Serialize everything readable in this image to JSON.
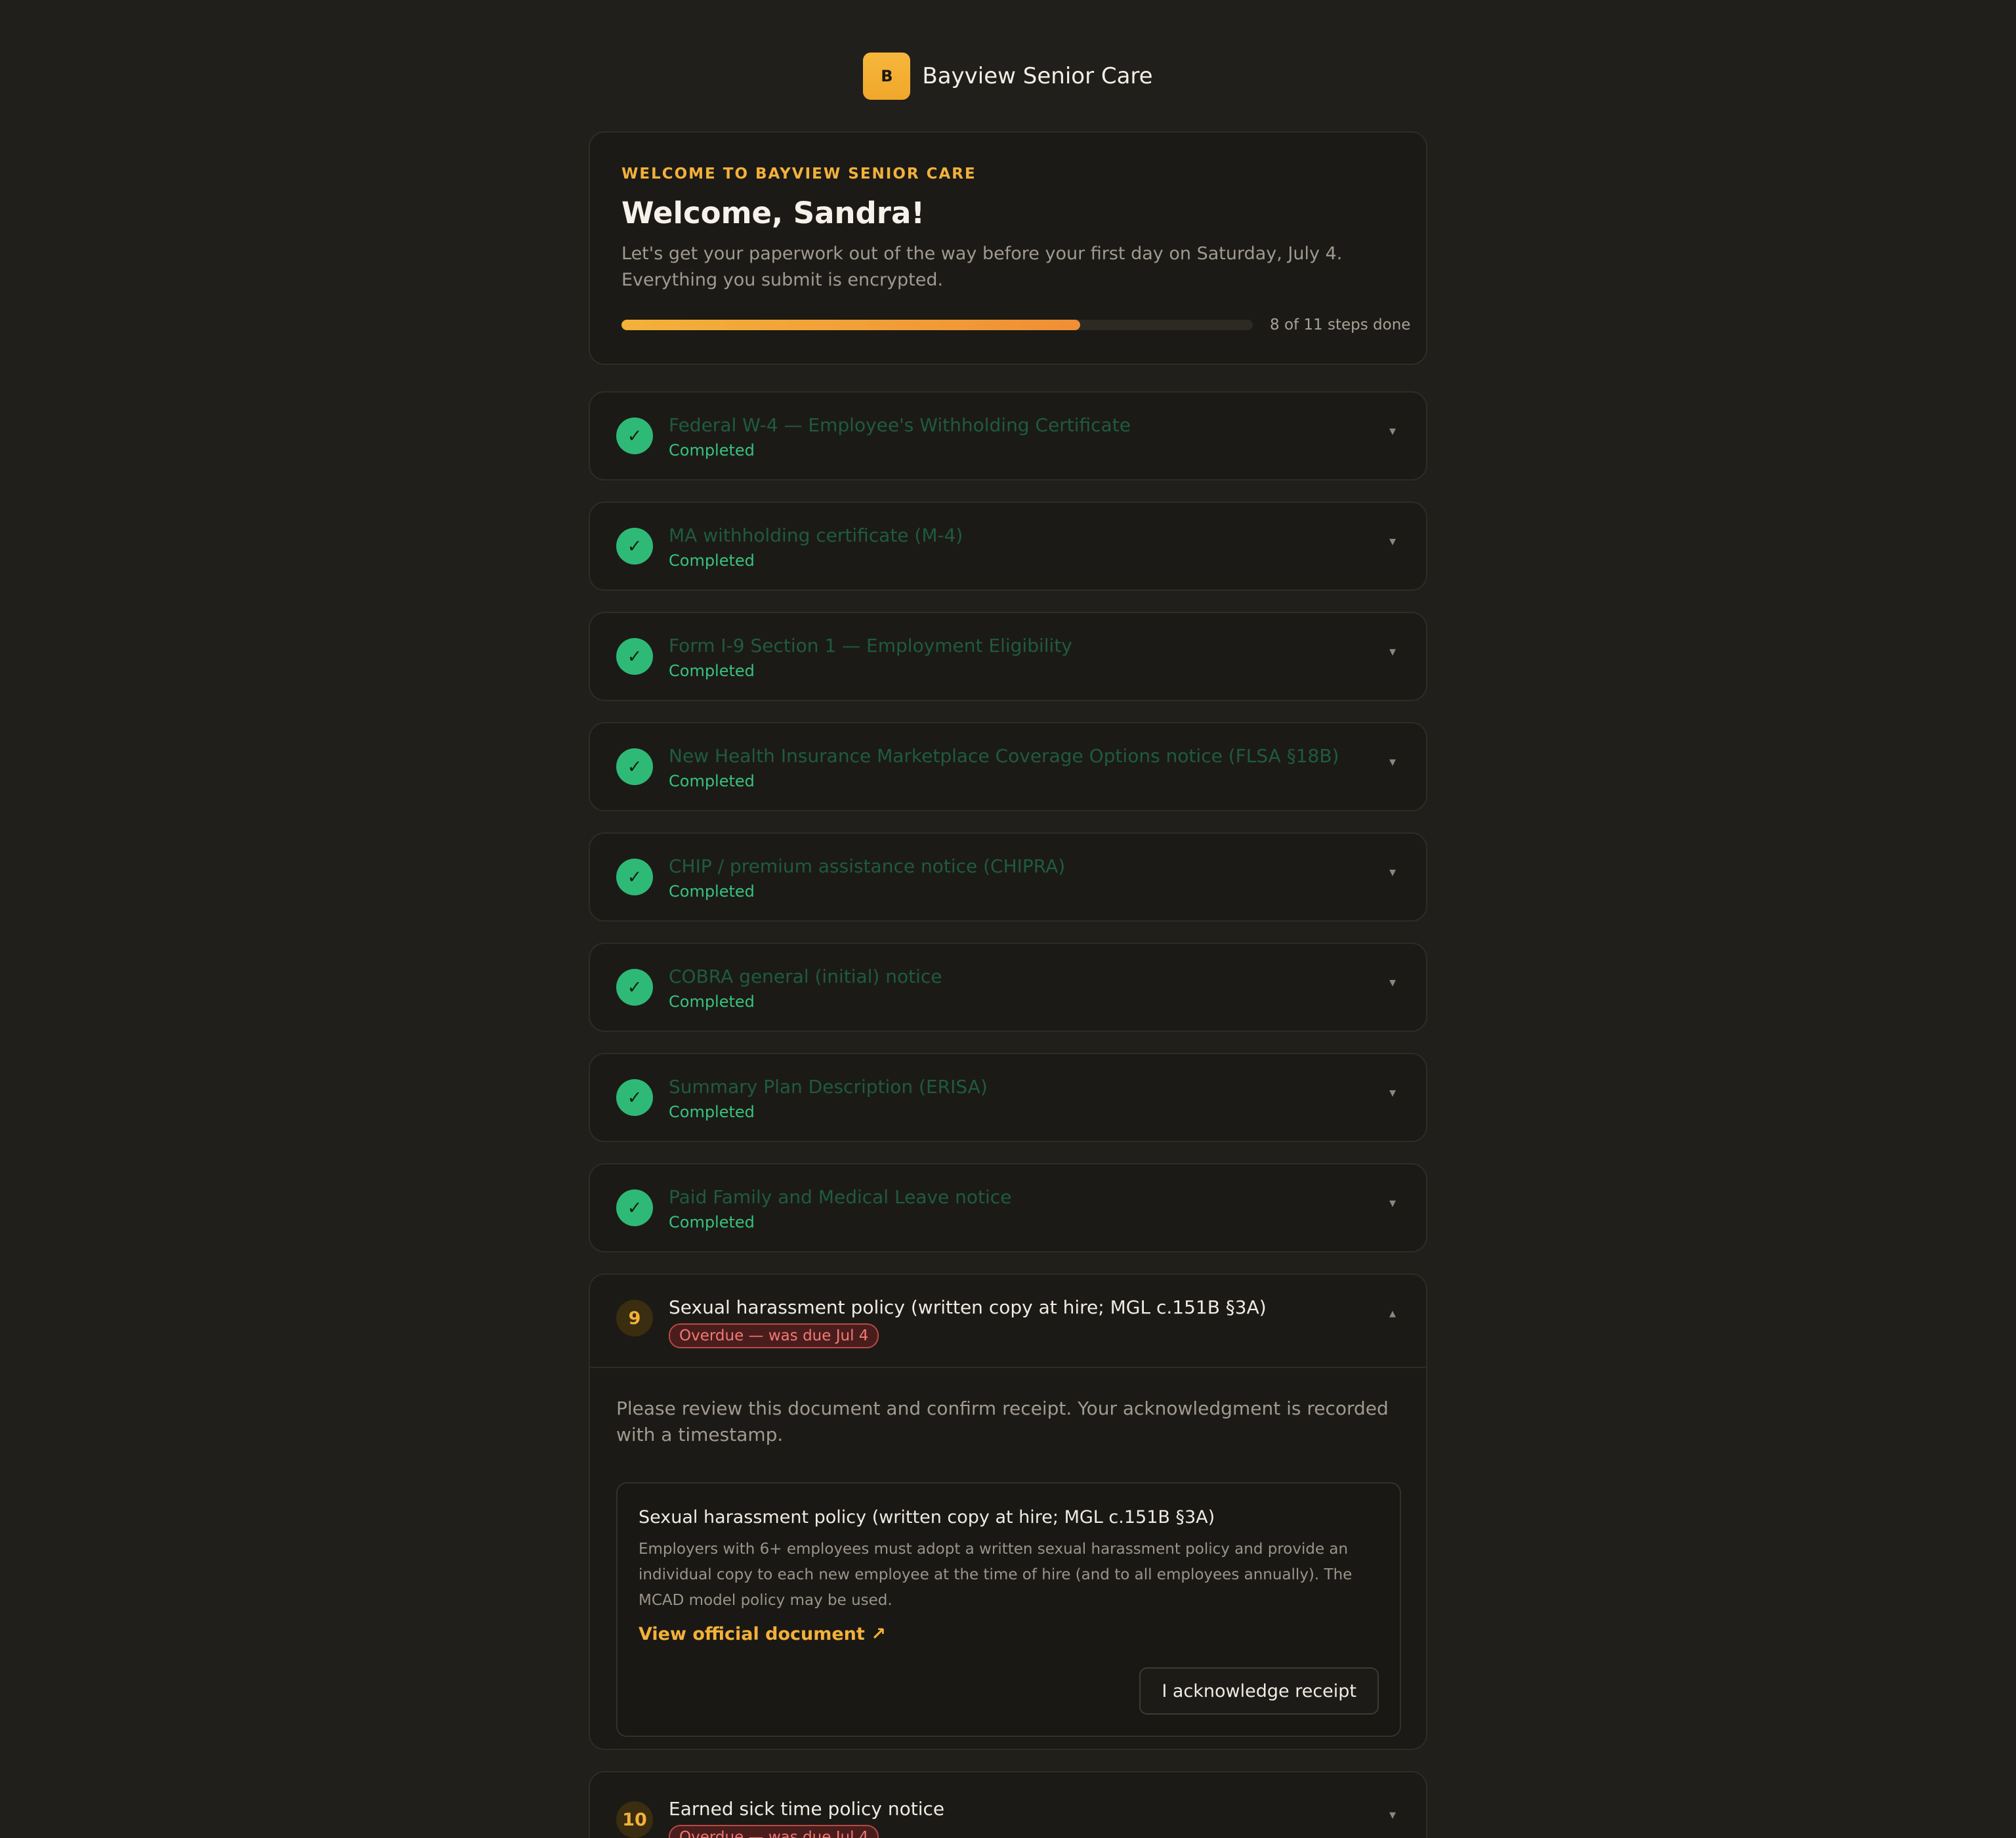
{
  "brand": {
    "logo_letter": "B",
    "name": "Bayview Senior Care"
  },
  "welcome": {
    "eyebrow": "WELCOME TO BAYVIEW SENIOR CARE",
    "title": "Welcome, Sandra!",
    "subtitle": "Let's get your paperwork out of the way before your first day on Saturday, July 4. Everything you submit is encrypted.",
    "progress_fraction": 0.727,
    "progress_text": "8 of 11 steps done"
  },
  "steps": [
    {
      "title": "Federal W-4 — Employee's Withholding Certificate",
      "status": "Completed",
      "icon": "check-icon"
    },
    {
      "title": "MA withholding certificate (M-4)",
      "status": "Completed",
      "icon": "check-icon"
    },
    {
      "title": "Form I-9 Section 1 — Employment Eligibility",
      "status": "Completed",
      "icon": "check-icon"
    },
    {
      "title": "New Health Insurance Marketplace Coverage Options notice (FLSA §18B)",
      "status": "Completed",
      "icon": "check-icon"
    },
    {
      "title": "CHIP / premium assistance notice (CHIPRA)",
      "status": "Completed",
      "icon": "check-icon"
    },
    {
      "title": "COBRA general (initial) notice",
      "status": "Completed",
      "icon": "check-icon"
    },
    {
      "title": "Summary Plan Description (ERISA)",
      "status": "Completed",
      "icon": "check-icon"
    },
    {
      "title": "Paid Family and Medical Leave notice",
      "status": "Completed",
      "icon": "check-icon"
    },
    {
      "number": "9",
      "title": "Sexual harassment policy (written copy at hire; MGL c.151B §3A)",
      "overdue": "Overdue — was due Jul 4",
      "expanded": true,
      "intro": "Please review this document and confirm receipt. Your acknowledgment is recorded with a timestamp.",
      "doc_title": "Sexual harassment policy (written copy at hire; MGL c.151B §3A)",
      "doc_desc": "Employers with 6+ employees must adopt a written sexual harassment policy and provide an individual copy to each new employee at the time of hire (and to all employees annually). The MCAD model policy may be used.",
      "doc_link": "View official document ↗",
      "ack_button": "I acknowledge receipt"
    },
    {
      "number": "10",
      "title": "Earned sick time policy notice",
      "overdue": "Overdue — was due Jul 4"
    }
  ],
  "chevrons": {
    "collapsed": "▾",
    "expanded": "▴"
  },
  "check_glyph": "✓",
  "colors": {
    "accent": "#f3b13a",
    "done_green": "#2eba76",
    "overdue_red": "#f07a72",
    "background": "#211f1b"
  }
}
